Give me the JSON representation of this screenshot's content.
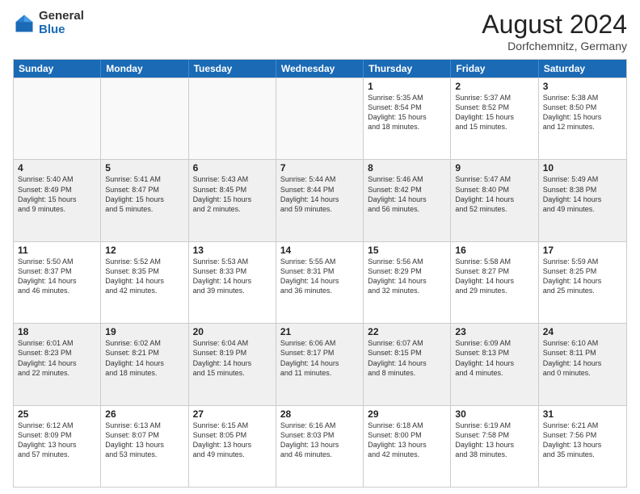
{
  "logo": {
    "general": "General",
    "blue": "Blue"
  },
  "title": {
    "month": "August 2024",
    "location": "Dorfchemnitz, Germany"
  },
  "calendar": {
    "headers": [
      "Sunday",
      "Monday",
      "Tuesday",
      "Wednesday",
      "Thursday",
      "Friday",
      "Saturday"
    ],
    "rows": [
      [
        {
          "day": "",
          "text": "",
          "empty": true
        },
        {
          "day": "",
          "text": "",
          "empty": true
        },
        {
          "day": "",
          "text": "",
          "empty": true
        },
        {
          "day": "",
          "text": "",
          "empty": true
        },
        {
          "day": "1",
          "text": "Sunrise: 5:35 AM\nSunset: 8:54 PM\nDaylight: 15 hours\nand 18 minutes.",
          "empty": false
        },
        {
          "day": "2",
          "text": "Sunrise: 5:37 AM\nSunset: 8:52 PM\nDaylight: 15 hours\nand 15 minutes.",
          "empty": false
        },
        {
          "day": "3",
          "text": "Sunrise: 5:38 AM\nSunset: 8:50 PM\nDaylight: 15 hours\nand 12 minutes.",
          "empty": false
        }
      ],
      [
        {
          "day": "4",
          "text": "Sunrise: 5:40 AM\nSunset: 8:49 PM\nDaylight: 15 hours\nand 9 minutes.",
          "empty": false
        },
        {
          "day": "5",
          "text": "Sunrise: 5:41 AM\nSunset: 8:47 PM\nDaylight: 15 hours\nand 5 minutes.",
          "empty": false
        },
        {
          "day": "6",
          "text": "Sunrise: 5:43 AM\nSunset: 8:45 PM\nDaylight: 15 hours\nand 2 minutes.",
          "empty": false
        },
        {
          "day": "7",
          "text": "Sunrise: 5:44 AM\nSunset: 8:44 PM\nDaylight: 14 hours\nand 59 minutes.",
          "empty": false
        },
        {
          "day": "8",
          "text": "Sunrise: 5:46 AM\nSunset: 8:42 PM\nDaylight: 14 hours\nand 56 minutes.",
          "empty": false
        },
        {
          "day": "9",
          "text": "Sunrise: 5:47 AM\nSunset: 8:40 PM\nDaylight: 14 hours\nand 52 minutes.",
          "empty": false
        },
        {
          "day": "10",
          "text": "Sunrise: 5:49 AM\nSunset: 8:38 PM\nDaylight: 14 hours\nand 49 minutes.",
          "empty": false
        }
      ],
      [
        {
          "day": "11",
          "text": "Sunrise: 5:50 AM\nSunset: 8:37 PM\nDaylight: 14 hours\nand 46 minutes.",
          "empty": false
        },
        {
          "day": "12",
          "text": "Sunrise: 5:52 AM\nSunset: 8:35 PM\nDaylight: 14 hours\nand 42 minutes.",
          "empty": false
        },
        {
          "day": "13",
          "text": "Sunrise: 5:53 AM\nSunset: 8:33 PM\nDaylight: 14 hours\nand 39 minutes.",
          "empty": false
        },
        {
          "day": "14",
          "text": "Sunrise: 5:55 AM\nSunset: 8:31 PM\nDaylight: 14 hours\nand 36 minutes.",
          "empty": false
        },
        {
          "day": "15",
          "text": "Sunrise: 5:56 AM\nSunset: 8:29 PM\nDaylight: 14 hours\nand 32 minutes.",
          "empty": false
        },
        {
          "day": "16",
          "text": "Sunrise: 5:58 AM\nSunset: 8:27 PM\nDaylight: 14 hours\nand 29 minutes.",
          "empty": false
        },
        {
          "day": "17",
          "text": "Sunrise: 5:59 AM\nSunset: 8:25 PM\nDaylight: 14 hours\nand 25 minutes.",
          "empty": false
        }
      ],
      [
        {
          "day": "18",
          "text": "Sunrise: 6:01 AM\nSunset: 8:23 PM\nDaylight: 14 hours\nand 22 minutes.",
          "empty": false
        },
        {
          "day": "19",
          "text": "Sunrise: 6:02 AM\nSunset: 8:21 PM\nDaylight: 14 hours\nand 18 minutes.",
          "empty": false
        },
        {
          "day": "20",
          "text": "Sunrise: 6:04 AM\nSunset: 8:19 PM\nDaylight: 14 hours\nand 15 minutes.",
          "empty": false
        },
        {
          "day": "21",
          "text": "Sunrise: 6:06 AM\nSunset: 8:17 PM\nDaylight: 14 hours\nand 11 minutes.",
          "empty": false
        },
        {
          "day": "22",
          "text": "Sunrise: 6:07 AM\nSunset: 8:15 PM\nDaylight: 14 hours\nand 8 minutes.",
          "empty": false
        },
        {
          "day": "23",
          "text": "Sunrise: 6:09 AM\nSunset: 8:13 PM\nDaylight: 14 hours\nand 4 minutes.",
          "empty": false
        },
        {
          "day": "24",
          "text": "Sunrise: 6:10 AM\nSunset: 8:11 PM\nDaylight: 14 hours\nand 0 minutes.",
          "empty": false
        }
      ],
      [
        {
          "day": "25",
          "text": "Sunrise: 6:12 AM\nSunset: 8:09 PM\nDaylight: 13 hours\nand 57 minutes.",
          "empty": false
        },
        {
          "day": "26",
          "text": "Sunrise: 6:13 AM\nSunset: 8:07 PM\nDaylight: 13 hours\nand 53 minutes.",
          "empty": false
        },
        {
          "day": "27",
          "text": "Sunrise: 6:15 AM\nSunset: 8:05 PM\nDaylight: 13 hours\nand 49 minutes.",
          "empty": false
        },
        {
          "day": "28",
          "text": "Sunrise: 6:16 AM\nSunset: 8:03 PM\nDaylight: 13 hours\nand 46 minutes.",
          "empty": false
        },
        {
          "day": "29",
          "text": "Sunrise: 6:18 AM\nSunset: 8:00 PM\nDaylight: 13 hours\nand 42 minutes.",
          "empty": false
        },
        {
          "day": "30",
          "text": "Sunrise: 6:19 AM\nSunset: 7:58 PM\nDaylight: 13 hours\nand 38 minutes.",
          "empty": false
        },
        {
          "day": "31",
          "text": "Sunrise: 6:21 AM\nSunset: 7:56 PM\nDaylight: 13 hours\nand 35 minutes.",
          "empty": false
        }
      ]
    ]
  }
}
